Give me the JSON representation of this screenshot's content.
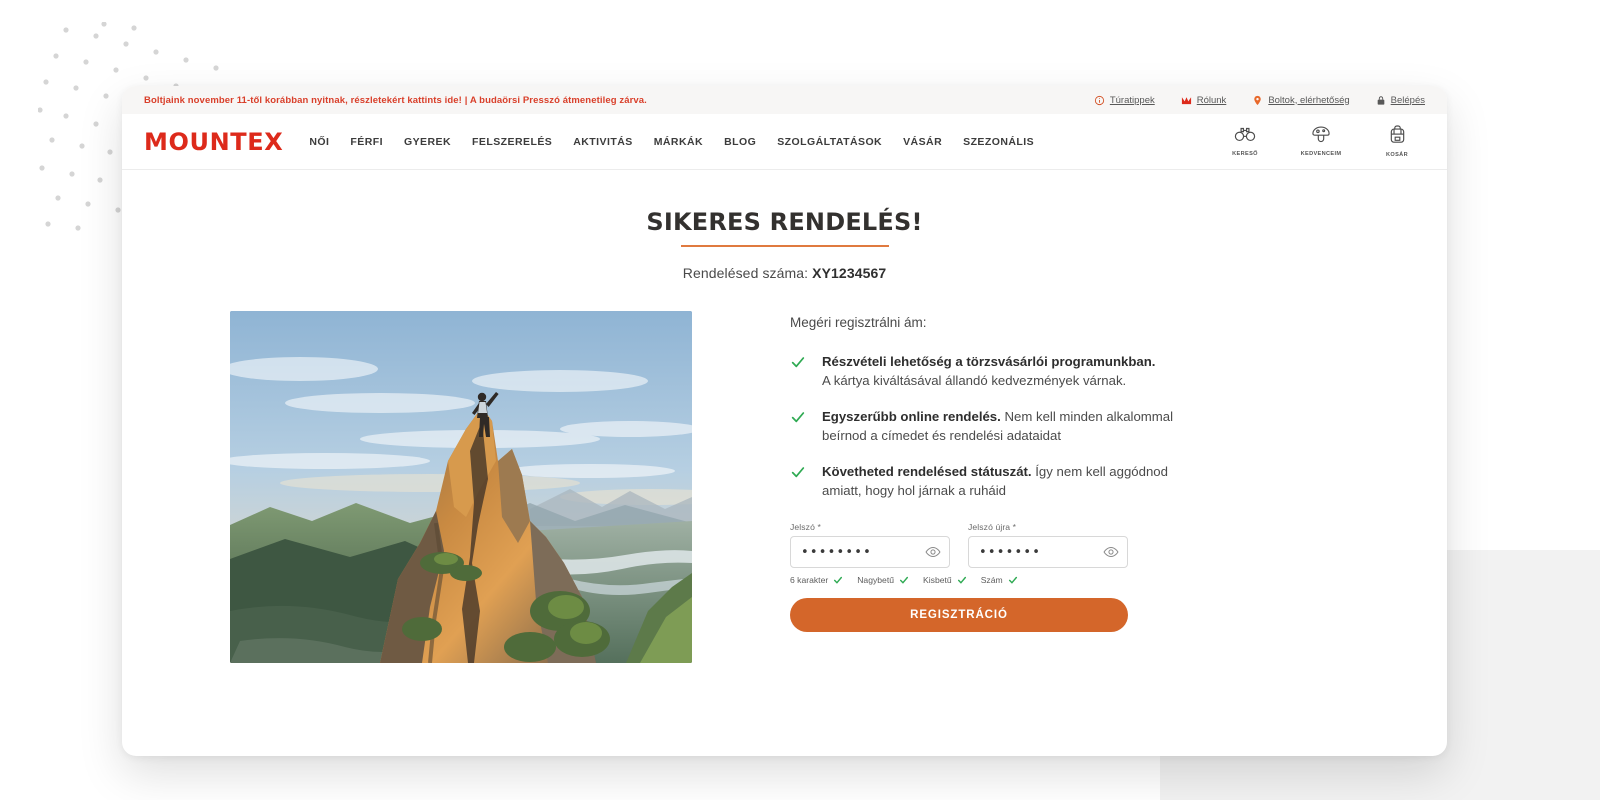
{
  "topbar": {
    "message": "Boltjaink november 11-től korábban nyitnak, részletekért kattints ide! | A budaörsi Presszó átmenetileg zárva.",
    "links": [
      {
        "label": "Túratippek",
        "icon": "info-circle-icon"
      },
      {
        "label": "Rólunk",
        "icon": "mountex-m-icon"
      },
      {
        "label": "Boltok, elérhetőség",
        "icon": "map-pin-icon"
      },
      {
        "label": "Belépés",
        "icon": "lock-icon"
      }
    ]
  },
  "header": {
    "logo": "MOUNTEX",
    "nav": [
      {
        "label": "NŐI"
      },
      {
        "label": "FÉRFI"
      },
      {
        "label": "GYEREK"
      },
      {
        "label": "FELSZERELÉS"
      },
      {
        "label": "AKTIVITÁS"
      },
      {
        "label": "MÁRKÁK"
      },
      {
        "label": "BLOG"
      },
      {
        "label": "SZOLGÁLTATÁSOK"
      },
      {
        "label": "VÁSÁR"
      },
      {
        "label": "SZEZONÁLIS"
      }
    ],
    "icons": [
      {
        "label": "KERESŐ",
        "icon": "binoculars-icon"
      },
      {
        "label": "KEDVENCEIM",
        "icon": "mushroom-icon"
      },
      {
        "label": "KOSÁR",
        "icon": "backpack-icon"
      }
    ]
  },
  "main": {
    "headline": "SIKERES RENDELÉS!",
    "order_label": "Rendelésed száma: ",
    "order_number": "XY1234567",
    "image_alt": "hiker-on-mountain-peak-photo",
    "intro": "Megéri regisztrálni ám:",
    "benefits": [
      {
        "bold": "Részvételi lehetőség a törzsvásárlói programunkban.",
        "rest": "",
        "second_line": "A kártya kiváltásával állandó kedvezmények várnak."
      },
      {
        "bold": "Egyszerűbb online rendelés.",
        "rest": " Nem kell minden alkalommal",
        "second_line": "beírnod a címedet és rendelési adataidat"
      },
      {
        "bold": "Követheted rendelésed státuszát.",
        "rest": " Így nem kell aggódnod",
        "second_line": "amiatt, hogy hol járnak a ruháid"
      }
    ],
    "form": {
      "password_label": "Jelszó *",
      "password_value": "••••••••",
      "password_repeat_label": "Jelszó újra *",
      "password_repeat_value": "•••••••",
      "reveal_icon": "eye-icon",
      "rules": [
        {
          "label": "6 karakter",
          "met": true
        },
        {
          "label": "Nagybetű",
          "met": true
        },
        {
          "label": "Kisbetű",
          "met": true
        },
        {
          "label": "Szám",
          "met": true
        }
      ],
      "submit_label": "REGISZTRÁCIÓ"
    }
  },
  "colors": {
    "brand_red": "#dd2a1b",
    "accent_orange": "#d4662a",
    "rule_orange": "#e07a3f",
    "success_green": "#2faa53",
    "alert_red": "#d93f2a"
  }
}
